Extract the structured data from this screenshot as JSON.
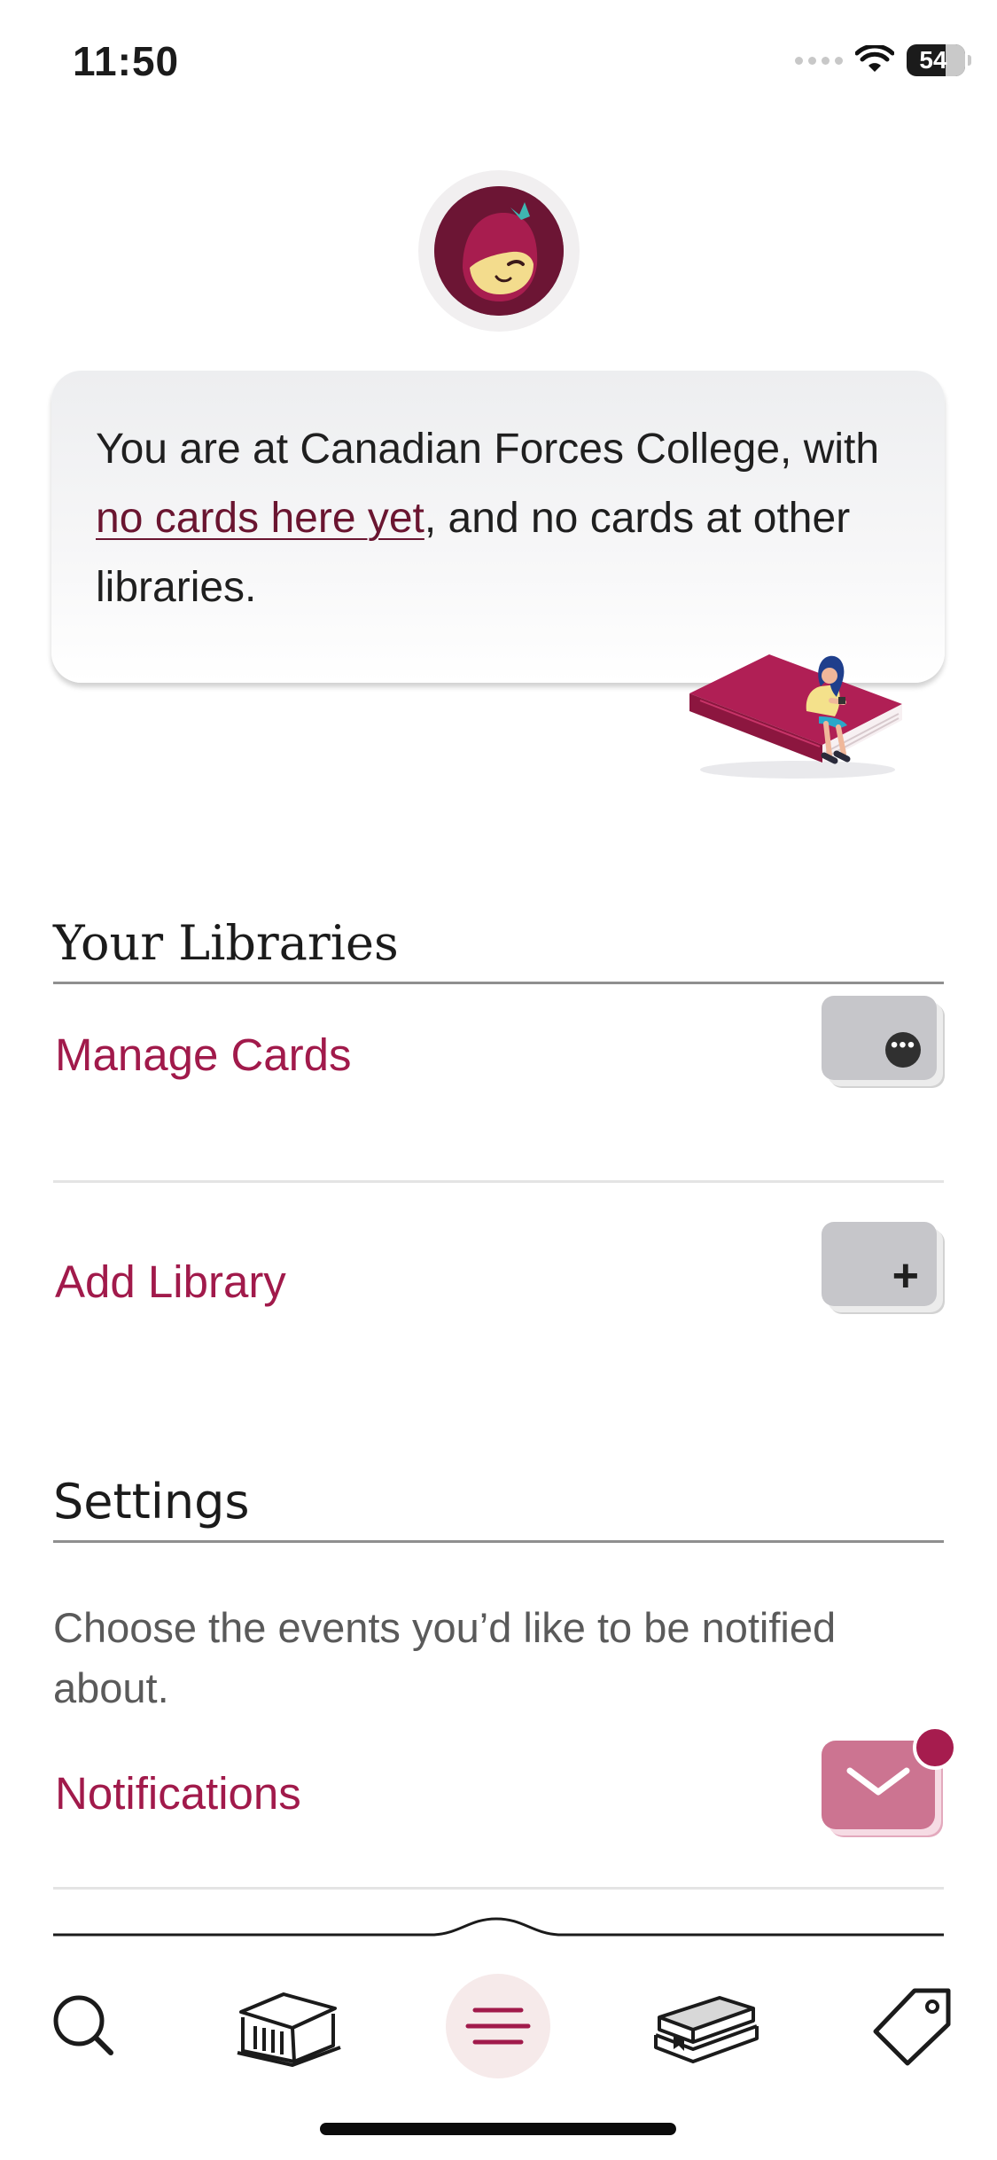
{
  "status_bar": {
    "time": "11:50",
    "battery": "54"
  },
  "summary": {
    "text_before_link": "You are at Canadian Forces College, with ",
    "link_text": "no cards here yet",
    "text_after_link": ", and no cards at other libraries."
  },
  "libraries": {
    "header": "Your Libraries",
    "manage_cards_label": "Manage Cards",
    "add_library_label": "Add Library"
  },
  "settings": {
    "header": "Settings",
    "description": "Choose the events you’d like to be notified about.",
    "notifications_label": "Notifications"
  },
  "icons": {
    "manage": "ellipsis-icon",
    "add": "plus-icon",
    "notifications": "envelope-icon"
  },
  "tab_bar": {
    "tabs": [
      "search-icon",
      "library-icon",
      "menu-icon",
      "shelf-icon",
      "tag-icon"
    ],
    "active": "menu-icon"
  },
  "colors": {
    "accent": "#a11a4b",
    "brand_dark": "#6c1534"
  }
}
